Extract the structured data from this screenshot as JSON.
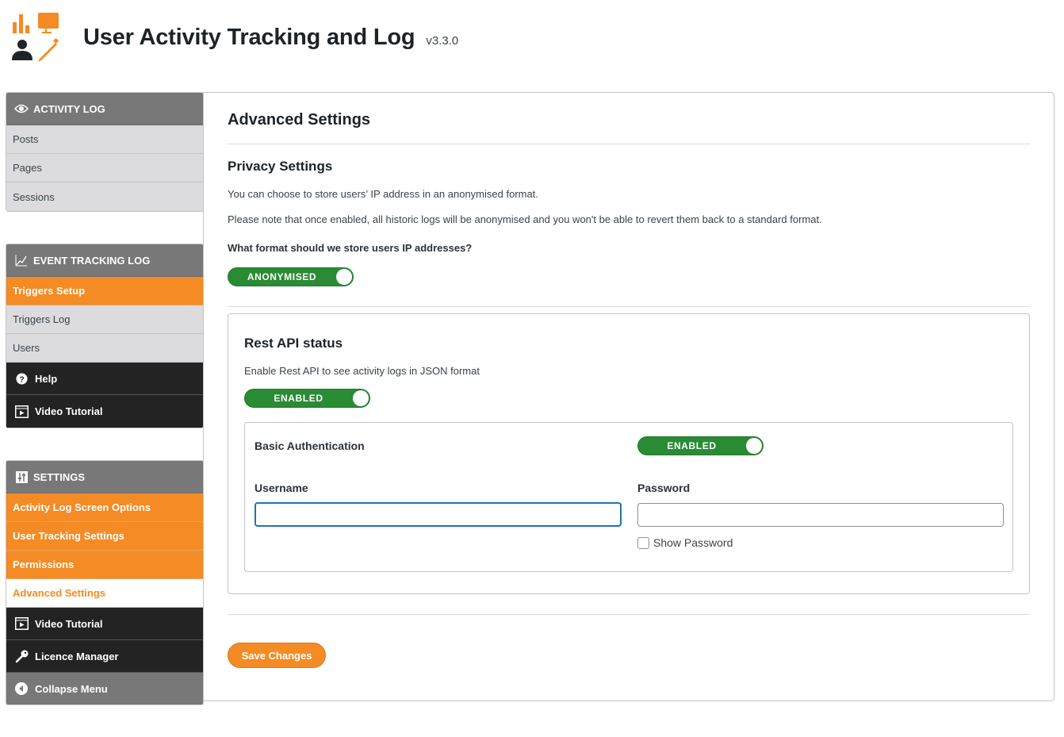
{
  "header": {
    "title": "User Activity Tracking and Log",
    "version": "v3.3.0",
    "logo_icon": "activity-tracking-logo-icon"
  },
  "colors": {
    "accent": "#f48b24",
    "toggle_on": "#2a8b35",
    "sidebar_header": "#787878",
    "sidebar_dark": "#232323",
    "focus_border": "#2271b1"
  },
  "sidebar": {
    "activity_log": {
      "title": "ACTIVITY LOG",
      "icon": "eye-icon",
      "items": [
        {
          "label": "Posts"
        },
        {
          "label": "Pages"
        },
        {
          "label": "Sessions"
        }
      ]
    },
    "event_tracking": {
      "title": "EVENT TRACKING LOG",
      "icon": "chart-line-icon",
      "items": [
        {
          "label": "Triggers Setup",
          "state": "highlighted"
        },
        {
          "label": "Triggers Log"
        },
        {
          "label": "Users"
        },
        {
          "label": "Help",
          "icon": "help-icon"
        },
        {
          "label": "Video Tutorial",
          "icon": "video-icon"
        }
      ]
    },
    "settings": {
      "title": "SETTINGS",
      "icon": "sliders-icon",
      "items": [
        {
          "label": "Activity Log Screen Options"
        },
        {
          "label": "User Tracking Settings"
        },
        {
          "label": "Permissions"
        },
        {
          "label": "Advanced Settings",
          "state": "active"
        },
        {
          "label": "Video Tutorial",
          "icon": "video-icon"
        },
        {
          "label": "Licence Manager",
          "icon": "key-icon"
        },
        {
          "label": "Collapse Menu",
          "icon": "collapse-icon"
        }
      ]
    }
  },
  "main": {
    "title": "Advanced Settings",
    "privacy": {
      "heading": "Privacy Settings",
      "desc1": "You can choose to store users’ IP address in an anonymised format.",
      "desc2": "Please note that once enabled, all historic logs will be anonymised and you won't be able to revert them back to a standard format.",
      "question": "What format should we store users IP addresses?",
      "toggle_label": "ANONYMISED",
      "toggle_on": true
    },
    "rest_api": {
      "heading": "Rest API status",
      "desc": "Enable Rest API to see activity logs in JSON format",
      "toggle_label": "ENABLED",
      "toggle_on": true,
      "basic_auth": {
        "label": "Basic Authentication",
        "toggle_label": "ENABLED",
        "toggle_on": true,
        "username_label": "Username",
        "username_value": "",
        "password_label": "Password",
        "password_value": "",
        "show_password_label": "Show Password",
        "show_password_checked": false
      }
    },
    "save_label": "Save Changes"
  }
}
